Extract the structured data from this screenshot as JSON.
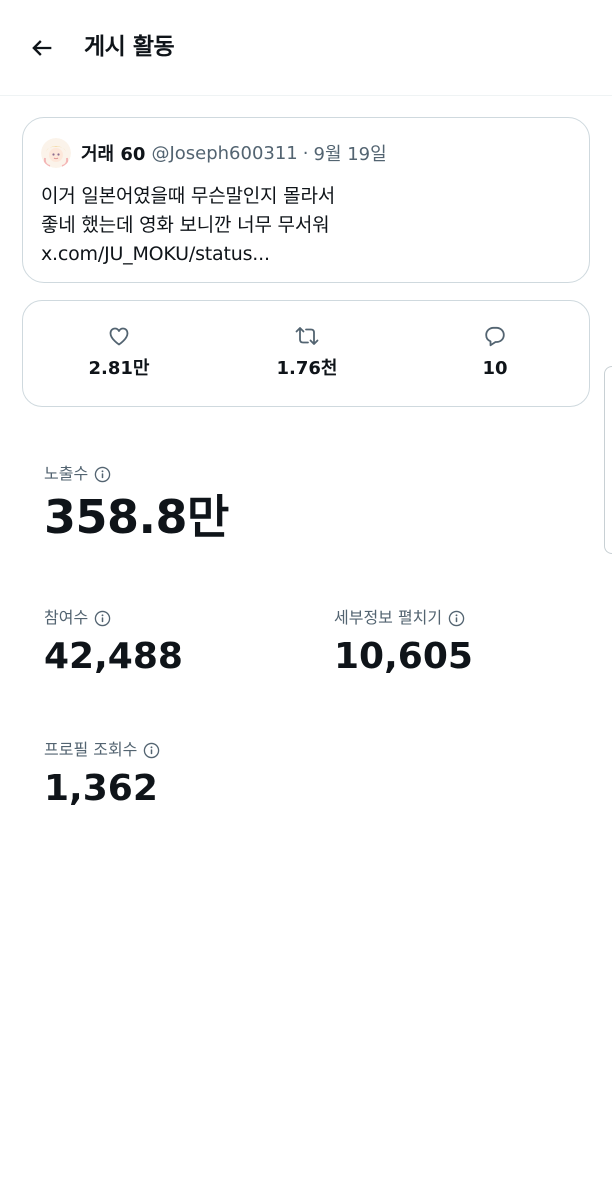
{
  "header": {
    "title": "게시 활동",
    "back_icon": "back-arrow-icon"
  },
  "tweet": {
    "author_name": "거래 60",
    "author_handle": "@Joseph600311",
    "separator": "·",
    "date": "9월 19일",
    "lines": [
      "이거 일본어였을때 무슨말인지 몰라서",
      "좋네 했는데 영화 보니깐 너무 무서워",
      "x.com/JU_MOKU/status..."
    ]
  },
  "engagement": {
    "likes": {
      "icon": "heart-icon",
      "value": "2.81만"
    },
    "reposts": {
      "icon": "repost-icon",
      "value": "1.76천"
    },
    "replies": {
      "icon": "reply-icon",
      "value": "10"
    }
  },
  "metrics": {
    "impressions": {
      "label": "노출수",
      "value": "358.8만"
    },
    "engagements": {
      "label": "참여수",
      "value": "42,488"
    },
    "detail_expands": {
      "label": "세부정보 펼치기",
      "value": "10,605"
    },
    "profile_visits": {
      "label": "프로필 조회수",
      "value": "1,362"
    }
  },
  "colors": {
    "text_primary": "#0f1419",
    "text_secondary": "#536471",
    "border": "#cfd9de"
  }
}
